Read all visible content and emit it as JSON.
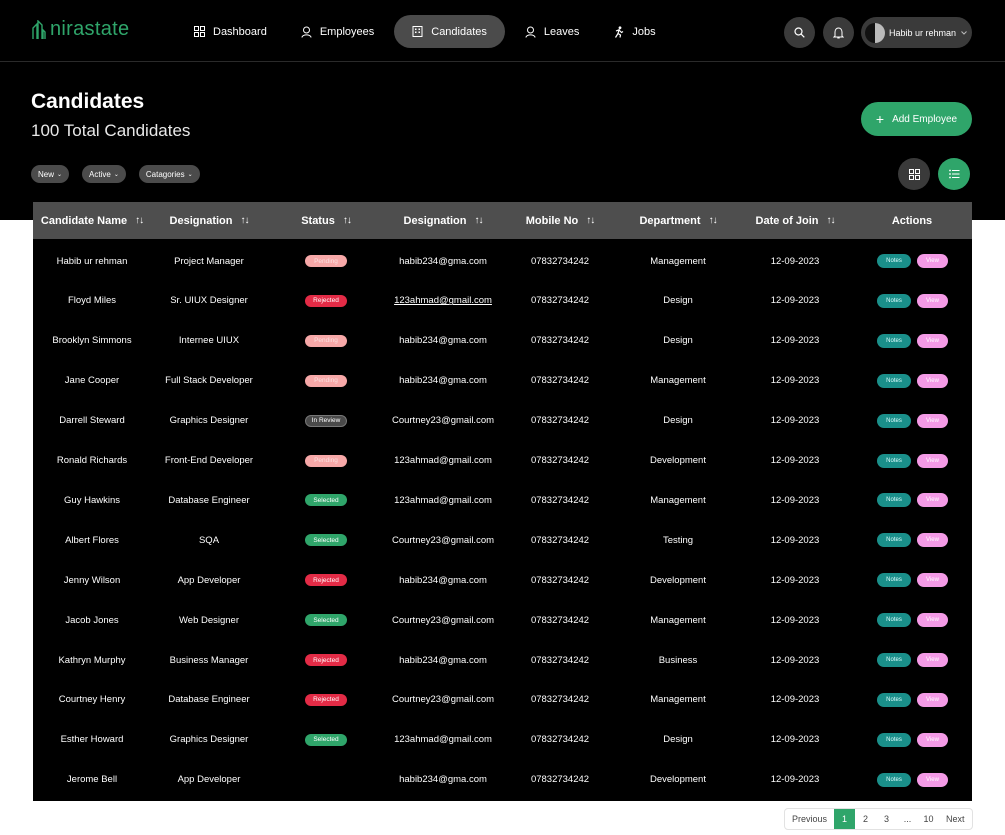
{
  "app": {
    "logo_text": "nirastate"
  },
  "nav": [
    {
      "label": "Dashboard",
      "icon": "grid-icon"
    },
    {
      "label": "Employees",
      "icon": "user-icon"
    },
    {
      "label": "Candidates",
      "icon": "building-icon"
    },
    {
      "label": "Leaves",
      "icon": "user-icon"
    },
    {
      "label": "Jobs",
      "icon": "running-icon"
    }
  ],
  "user": {
    "name": "Habib ur rehman"
  },
  "page": {
    "title": "Candidates",
    "subtitle": "100 Total Candidates",
    "add_button": "Add Employee"
  },
  "filters": [
    "New",
    "Active",
    "Catagories"
  ],
  "table": {
    "headers": [
      "Candidate Name",
      "Designation",
      "Status",
      "Designation",
      "Mobile No",
      "Department",
      "Date of Join",
      "Actions"
    ],
    "action_notes": "Notes",
    "action_view": "View",
    "rows": [
      {
        "name": "Habib ur rehman",
        "designation": "Project Manager",
        "status": "Pending",
        "email": "habib234@gma.com",
        "mobile": "07832734242",
        "department": "Management",
        "date": "12-09-2023"
      },
      {
        "name": "Floyd Miles",
        "designation": "Sr. UIUX Designer",
        "status": "Rejected",
        "email": "123ahmad@gmail.com",
        "mobile": "07832734242",
        "department": "Design",
        "date": "12-09-2023"
      },
      {
        "name": "Brooklyn Simmons",
        "designation": "Internee UIUX",
        "status": "Pending",
        "email": "habib234@gma.com",
        "mobile": "07832734242",
        "department": "Design",
        "date": "12-09-2023"
      },
      {
        "name": "Jane Cooper",
        "designation": "Full Stack Developer",
        "status": "Pending",
        "email": "habib234@gma.com",
        "mobile": "07832734242",
        "department": "Management",
        "date": "12-09-2023"
      },
      {
        "name": "Darrell Steward",
        "designation": "Graphics Designer",
        "status": "In Review",
        "email": "Courtney23@gmail.com",
        "mobile": "07832734242",
        "department": "Design",
        "date": "12-09-2023"
      },
      {
        "name": "Ronald Richards",
        "designation": "Front-End Developer",
        "status": "Pending",
        "email": "123ahmad@gmail.com",
        "mobile": "07832734242",
        "department": "Development",
        "date": "12-09-2023"
      },
      {
        "name": "Guy Hawkins",
        "designation": "Database Engineer",
        "status": "Selected",
        "email": "123ahmad@gmail.com",
        "mobile": "07832734242",
        "department": "Management",
        "date": "12-09-2023"
      },
      {
        "name": "Albert Flores",
        "designation": "SQA",
        "status": "Selected",
        "email": "Courtney23@gmail.com",
        "mobile": "07832734242",
        "department": "Testing",
        "date": "12-09-2023"
      },
      {
        "name": "Jenny Wilson",
        "designation": "App Developer",
        "status": "Rejected",
        "email": "habib234@gma.com",
        "mobile": "07832734242",
        "department": "Development",
        "date": "12-09-2023"
      },
      {
        "name": "Jacob Jones",
        "designation": "Web Designer",
        "status": "Selected",
        "email": "Courtney23@gmail.com",
        "mobile": "07832734242",
        "department": "Management",
        "date": "12-09-2023"
      },
      {
        "name": "Kathryn Murphy",
        "designation": "Business Manager",
        "status": "Rejected",
        "email": "habib234@gma.com",
        "mobile": "07832734242",
        "department": "Business",
        "date": "12-09-2023"
      },
      {
        "name": "Courtney Henry",
        "designation": "Database Engineer",
        "status": "Rejected",
        "email": "Courtney23@gmail.com",
        "mobile": "07832734242",
        "department": "Management",
        "date": "12-09-2023"
      },
      {
        "name": "Esther Howard",
        "designation": "Graphics Designer",
        "status": "Selected",
        "email": "123ahmad@gmail.com",
        "mobile": "07832734242",
        "department": "Design",
        "date": "12-09-2023"
      },
      {
        "name": "Jerome Bell",
        "designation": "App Developer",
        "status": "",
        "email": "habib234@gma.com",
        "mobile": "07832734242",
        "department": "Development",
        "date": "12-09-2023"
      }
    ]
  },
  "status_colors": {
    "Pending": "#f7a8a8",
    "Rejected": "#e32b46",
    "In Review": "#4a4a4a",
    "Selected": "#2fa56a"
  },
  "colors": {
    "accent": "#2fa56a",
    "notes": "#1a8f8a",
    "view": "#f49ae6"
  },
  "pagination": {
    "previous": "Previous",
    "pages": [
      "1",
      "2",
      "3",
      "...",
      "10"
    ],
    "next": "Next",
    "current": "1"
  }
}
